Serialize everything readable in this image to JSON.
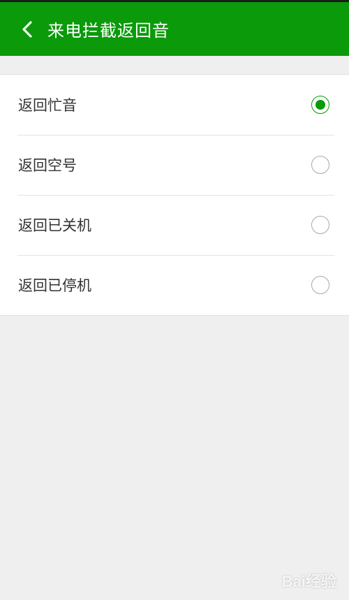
{
  "header": {
    "title": "来电拦截返回音",
    "background": "#0a9a0a"
  },
  "options": [
    {
      "label": "返回忙音",
      "selected": true
    },
    {
      "label": "返回空号",
      "selected": false
    },
    {
      "label": "返回已关机",
      "selected": false
    },
    {
      "label": "返回已停机",
      "selected": false
    }
  ],
  "watermark": {
    "text": "Bai经验"
  }
}
